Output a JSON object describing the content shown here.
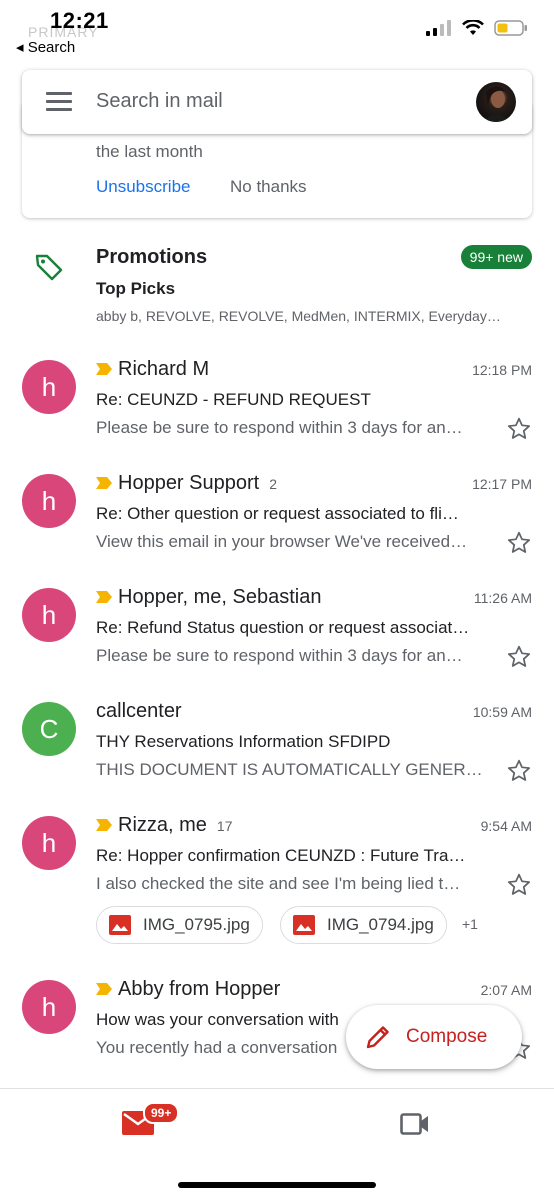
{
  "status_bar": {
    "time": "12:21",
    "back_label": "◂ Search",
    "ghost_label": "PRIMARY"
  },
  "search": {
    "placeholder": "Search in mail"
  },
  "unsubscribe_card": {
    "text": "the last month",
    "unsubscribe_label": "Unsubscribe",
    "no_thanks_label": "No thanks"
  },
  "promotions": {
    "title": "Promotions",
    "badge": "99+ new",
    "subtitle": "Top Picks",
    "senders": "abby b, REVOLVE, REVOLVE, MedMen, INTERMIX, Everyday…"
  },
  "emails": [
    {
      "initial": "h",
      "avatar_color": "#d9477a",
      "sender": "Richard M",
      "count": "",
      "time": "12:18 PM",
      "important": true,
      "subject": "Re: CEUNZD - REFUND REQUEST",
      "snippet": "Please be sure to respond within 3 days for an…"
    },
    {
      "initial": "h",
      "avatar_color": "#d9477a",
      "sender": "Hopper Support",
      "count": "2",
      "time": "12:17 PM",
      "important": true,
      "subject": "Re: Other question or request associated to fli…",
      "snippet": "View this email in your browser We've received…"
    },
    {
      "initial": "h",
      "avatar_color": "#d9477a",
      "sender": "Hopper, me, Sebastian",
      "count": "",
      "time": "11:26 AM",
      "important": true,
      "subject": "Re: Refund Status question or request associat…",
      "snippet": "Please be sure to respond within 3 days for an…"
    },
    {
      "initial": "C",
      "avatar_color": "#4caf50",
      "sender": "callcenter",
      "count": "",
      "time": "10:59 AM",
      "important": false,
      "subject": "THY Reservations Information SFDIPD",
      "snippet": "THIS DOCUMENT IS AUTOMATICALLY GENER…"
    },
    {
      "initial": "h",
      "avatar_color": "#d9477a",
      "sender": "Rizza, me",
      "count": "17",
      "time": "9:54 AM",
      "important": true,
      "subject": "Re: Hopper confirmation CEUNZD   : Future Tra…",
      "snippet": "I also checked the site and see I'm being lied t…"
    },
    {
      "initial": "h",
      "avatar_color": "#d9477a",
      "sender": "Abby from Hopper",
      "count": "",
      "time": "2:07 AM",
      "important": true,
      "subject": "How was your conversation with",
      "snippet": "You recently had a conversation"
    }
  ],
  "attachments": {
    "items": [
      "IMG_0795.jpg",
      "IMG_0794.jpg"
    ],
    "more": "+1"
  },
  "compose": {
    "label": "Compose"
  },
  "bottom_nav": {
    "mail_badge": "99+"
  },
  "colors": {
    "accent_red": "#c5221f",
    "link_blue": "#1a73e8",
    "promo_green": "#188038",
    "important_yellow": "#f4b400"
  }
}
